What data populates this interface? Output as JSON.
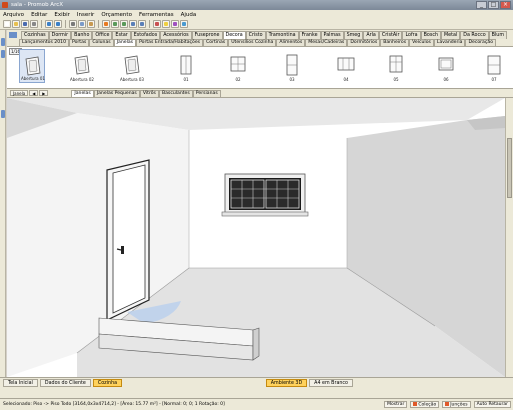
{
  "window": {
    "title": "sala - Promob ArcX",
    "minimize": "_",
    "maximize": "□",
    "close": "×"
  },
  "menu": [
    "Arquivo",
    "Editar",
    "Exibir",
    "Inserir",
    "Orçamento",
    "Ferramentas",
    "Ajuda"
  ],
  "toolbar_icons": [
    "new-icon",
    "open-icon",
    "save-icon",
    "print-icon",
    "undo-icon",
    "redo-icon",
    "cut-icon",
    "copy-icon",
    "paste-icon",
    "select-icon",
    "move-icon",
    "rotate-icon",
    "zoom-icon",
    "pan-icon",
    "render-icon",
    "light-icon",
    "color-icon",
    "measure-icon"
  ],
  "category_tabs": [
    "Cozinhas",
    "Dormir",
    "Banho",
    "Office",
    "Estar",
    "Estofados",
    "Acessórios",
    "Fuseprone",
    "Decora",
    "Cristo",
    "Tramontina",
    "Franke",
    "Palmas",
    "Smeg",
    "Arla",
    "CristAir",
    "Lofra",
    "Bosch",
    "Metal",
    "Da Rocco",
    "Blum"
  ],
  "category_tabs_active": "Decora",
  "sub_tabs": [
    "Lançamentos 2010",
    "Portas",
    "Colunas",
    "Janelas",
    "Portas Entrada/Habitações",
    "Cortinas",
    "Utensílios Cozinha",
    "Alimentos",
    "Mesas/Cadeiras",
    "Dormitórios",
    "Banheiros",
    "Veículos",
    "Lavanderia",
    "Decoração"
  ],
  "sub_tabs_active": "Janelas",
  "catalog": {
    "zoom": "1/16",
    "items": [
      {
        "label": "Abertura 01"
      },
      {
        "label": "Abertura 02"
      },
      {
        "label": "Abertura 03"
      },
      {
        "label": "01"
      },
      {
        "label": "02"
      },
      {
        "label": "03"
      },
      {
        "label": "04"
      },
      {
        "label": "05"
      },
      {
        "label": "06"
      },
      {
        "label": "07"
      }
    ]
  },
  "catalog_footer": {
    "view_mode": "Janela",
    "tabs": [
      "Janelas",
      "Janelas Pequenas",
      "Vitrôs",
      "Basculantes",
      "Persianas"
    ],
    "active": "Janelas"
  },
  "document_tabs": {
    "left": [
      "Tela Inicial",
      "Dados do Cliente",
      "Cozinha"
    ],
    "left_active": "Cozinha",
    "right": [
      "Ambiente 3D",
      "A4 em Branco"
    ],
    "right_active": "Ambiente 3D"
  },
  "status": {
    "info": "Selecionado: Piso -> Piso Todo [3164,0x3x4714,2] - [Área: 15.77 m²] - [Normal: 0; 0; 1 Rotação: 0]",
    "show": "Mostrar",
    "buttons": [
      "Coleção",
      "Junções",
      "Auto Retaurar"
    ]
  },
  "colors": {
    "accent": "#ffd25c",
    "floor_selection": "#b9cfee"
  }
}
